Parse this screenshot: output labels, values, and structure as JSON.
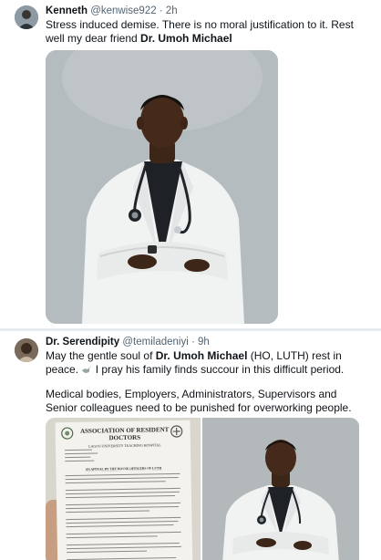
{
  "tweet1": {
    "name": "Kenneth",
    "handle": "@kenwise922",
    "separator": "·",
    "time": "2h",
    "text_part1": "Stress induced demise. There is no moral justification to it. Rest well my dear friend ",
    "text_bold": "Dr. Umoh Michael",
    "photo_icon": "doctor-portrait-image"
  },
  "tweet2": {
    "name": "Dr. Serendipity",
    "handle": "@temiladeniyi",
    "separator": "·",
    "time": "9h",
    "text_part1": "May the gentle soul of ",
    "text_bold": "Dr. Umoh Michael",
    "text_part2": " (HO, LUTH) rest in peace. ",
    "text_part3": " I pray his family finds succour in this difficult period.",
    "text_para2": "Medical bodies, Employers, Administrators, Supervisors and Senior colleagues need to be punished for overworking people.",
    "emoji_icon": "dove-icon",
    "letter_heading": "ASSOCIATION OF RESIDENT DOCTORS",
    "letter_subheading": "LAGOS UNIVERSITY TEACHING HOSPITAL",
    "letter_title": "AN APPEAL BY THE HOUSE OFFICERS OF LUTH"
  },
  "colors": {
    "text": "#0f1419",
    "secondary": "#536471",
    "separator": "#e6ecf0",
    "photo_bg": "#b5bcc0"
  }
}
